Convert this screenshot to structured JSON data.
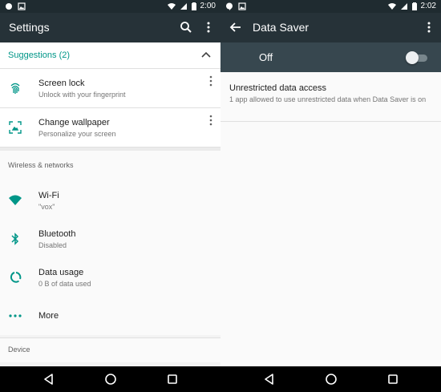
{
  "colors": {
    "status_bar": "#1f2b30",
    "app_bar": "#263238",
    "switch_bar": "#37474f",
    "accent": "#009688",
    "background": "#fafafa",
    "nav_bar": "#000000"
  },
  "left": {
    "status_bar": {
      "time": "2:00",
      "left_icons": [
        "circle-notification-icon",
        "image-notification-icon"
      ],
      "right_icons": [
        "wifi-icon",
        "signal-icon",
        "battery-icon"
      ]
    },
    "app_bar": {
      "title": "Settings",
      "icons": [
        "search-icon",
        "more-vert-icon"
      ]
    },
    "suggestions": {
      "header": "Suggestions (2)",
      "icon": "chevron-up-icon",
      "items": [
        {
          "icon": "fingerprint-icon",
          "title": "Screen lock",
          "subtitle": "Unlock with your fingerprint"
        },
        {
          "icon": "wallpaper-icon",
          "title": "Change wallpaper",
          "subtitle": "Personalize your screen"
        }
      ]
    },
    "sections": {
      "wireless": "Wireless & networks",
      "device": "Device"
    },
    "wireless_items": [
      {
        "icon": "wifi-icon",
        "title": "Wi-Fi",
        "subtitle": "\"vox\""
      },
      {
        "icon": "bluetooth-icon",
        "title": "Bluetooth",
        "subtitle": "Disabled"
      },
      {
        "icon": "data-usage-icon",
        "title": "Data usage",
        "subtitle": "0 B of data used"
      },
      {
        "icon": "more-horiz-icon",
        "title": "More",
        "subtitle": ""
      }
    ],
    "nav_icons": [
      "back-icon",
      "home-icon",
      "recents-icon"
    ]
  },
  "right": {
    "status_bar": {
      "time": "2:02",
      "left_icons": [
        "hangouts-icon",
        "image-notification-icon"
      ],
      "right_icons": [
        "wifi-icon",
        "signal-icon",
        "battery-icon"
      ]
    },
    "app_bar": {
      "title": "Data Saver",
      "icons": [
        "back-arrow-icon",
        "more-vert-icon"
      ]
    },
    "switch": {
      "label": "Off",
      "checked": false
    },
    "unrestricted": {
      "title": "Unrestricted data access",
      "subtitle": "1 app allowed to use unrestricted data when Data Saver is on"
    },
    "nav_icons": [
      "back-icon",
      "home-icon",
      "recents-icon"
    ]
  }
}
